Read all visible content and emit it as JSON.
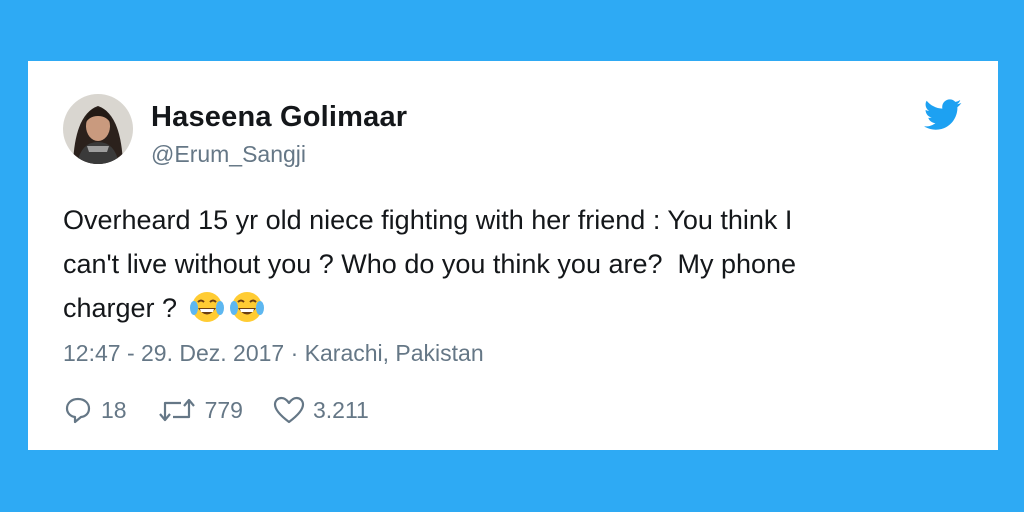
{
  "user": {
    "display_name": "Haseena Golimaar",
    "handle": "@Erum_Sangji"
  },
  "tweet": {
    "text": "Overheard 15 yr old niece fighting with her friend : You think I\ncan't live without you ? Who do you think you are?  My phone\ncharger ?",
    "emojis": [
      "face-with-tears-of-joy",
      "face-with-tears-of-joy"
    ],
    "timestamp_location": "12:47 - 29. Dez. 2017 · Karachi, Pakistan"
  },
  "actions": {
    "replies": "18",
    "retweets": "779",
    "likes": "3.211"
  },
  "colors": {
    "background": "#2eaaf4",
    "brand": "#1da1f2",
    "text": "#14171a",
    "muted": "#657786"
  },
  "icons": [
    "twitter-bird-icon",
    "reply-icon",
    "retweet-icon",
    "heart-icon"
  ]
}
